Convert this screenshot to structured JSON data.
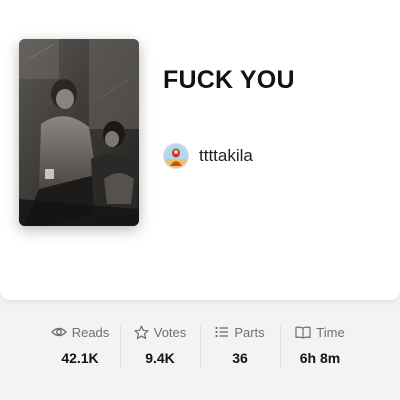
{
  "story": {
    "title": "FUCK YOU",
    "cover_icon": "book-cover-photo",
    "author": {
      "name": "ttttakila",
      "avatar_icon": "author-avatar"
    }
  },
  "stats": [
    {
      "icon": "eye-icon",
      "label": "Reads",
      "value": "42.1K"
    },
    {
      "icon": "star-icon",
      "label": "Votes",
      "value": "9.4K"
    },
    {
      "icon": "list-icon",
      "label": "Parts",
      "value": "36"
    },
    {
      "icon": "clock-icon",
      "label": "Time",
      "value": "6h 8m"
    }
  ],
  "colors": {
    "background": "#f3f3f3",
    "card": "#ffffff",
    "text_primary": "#121212",
    "text_secondary": "#6f6f6f"
  }
}
